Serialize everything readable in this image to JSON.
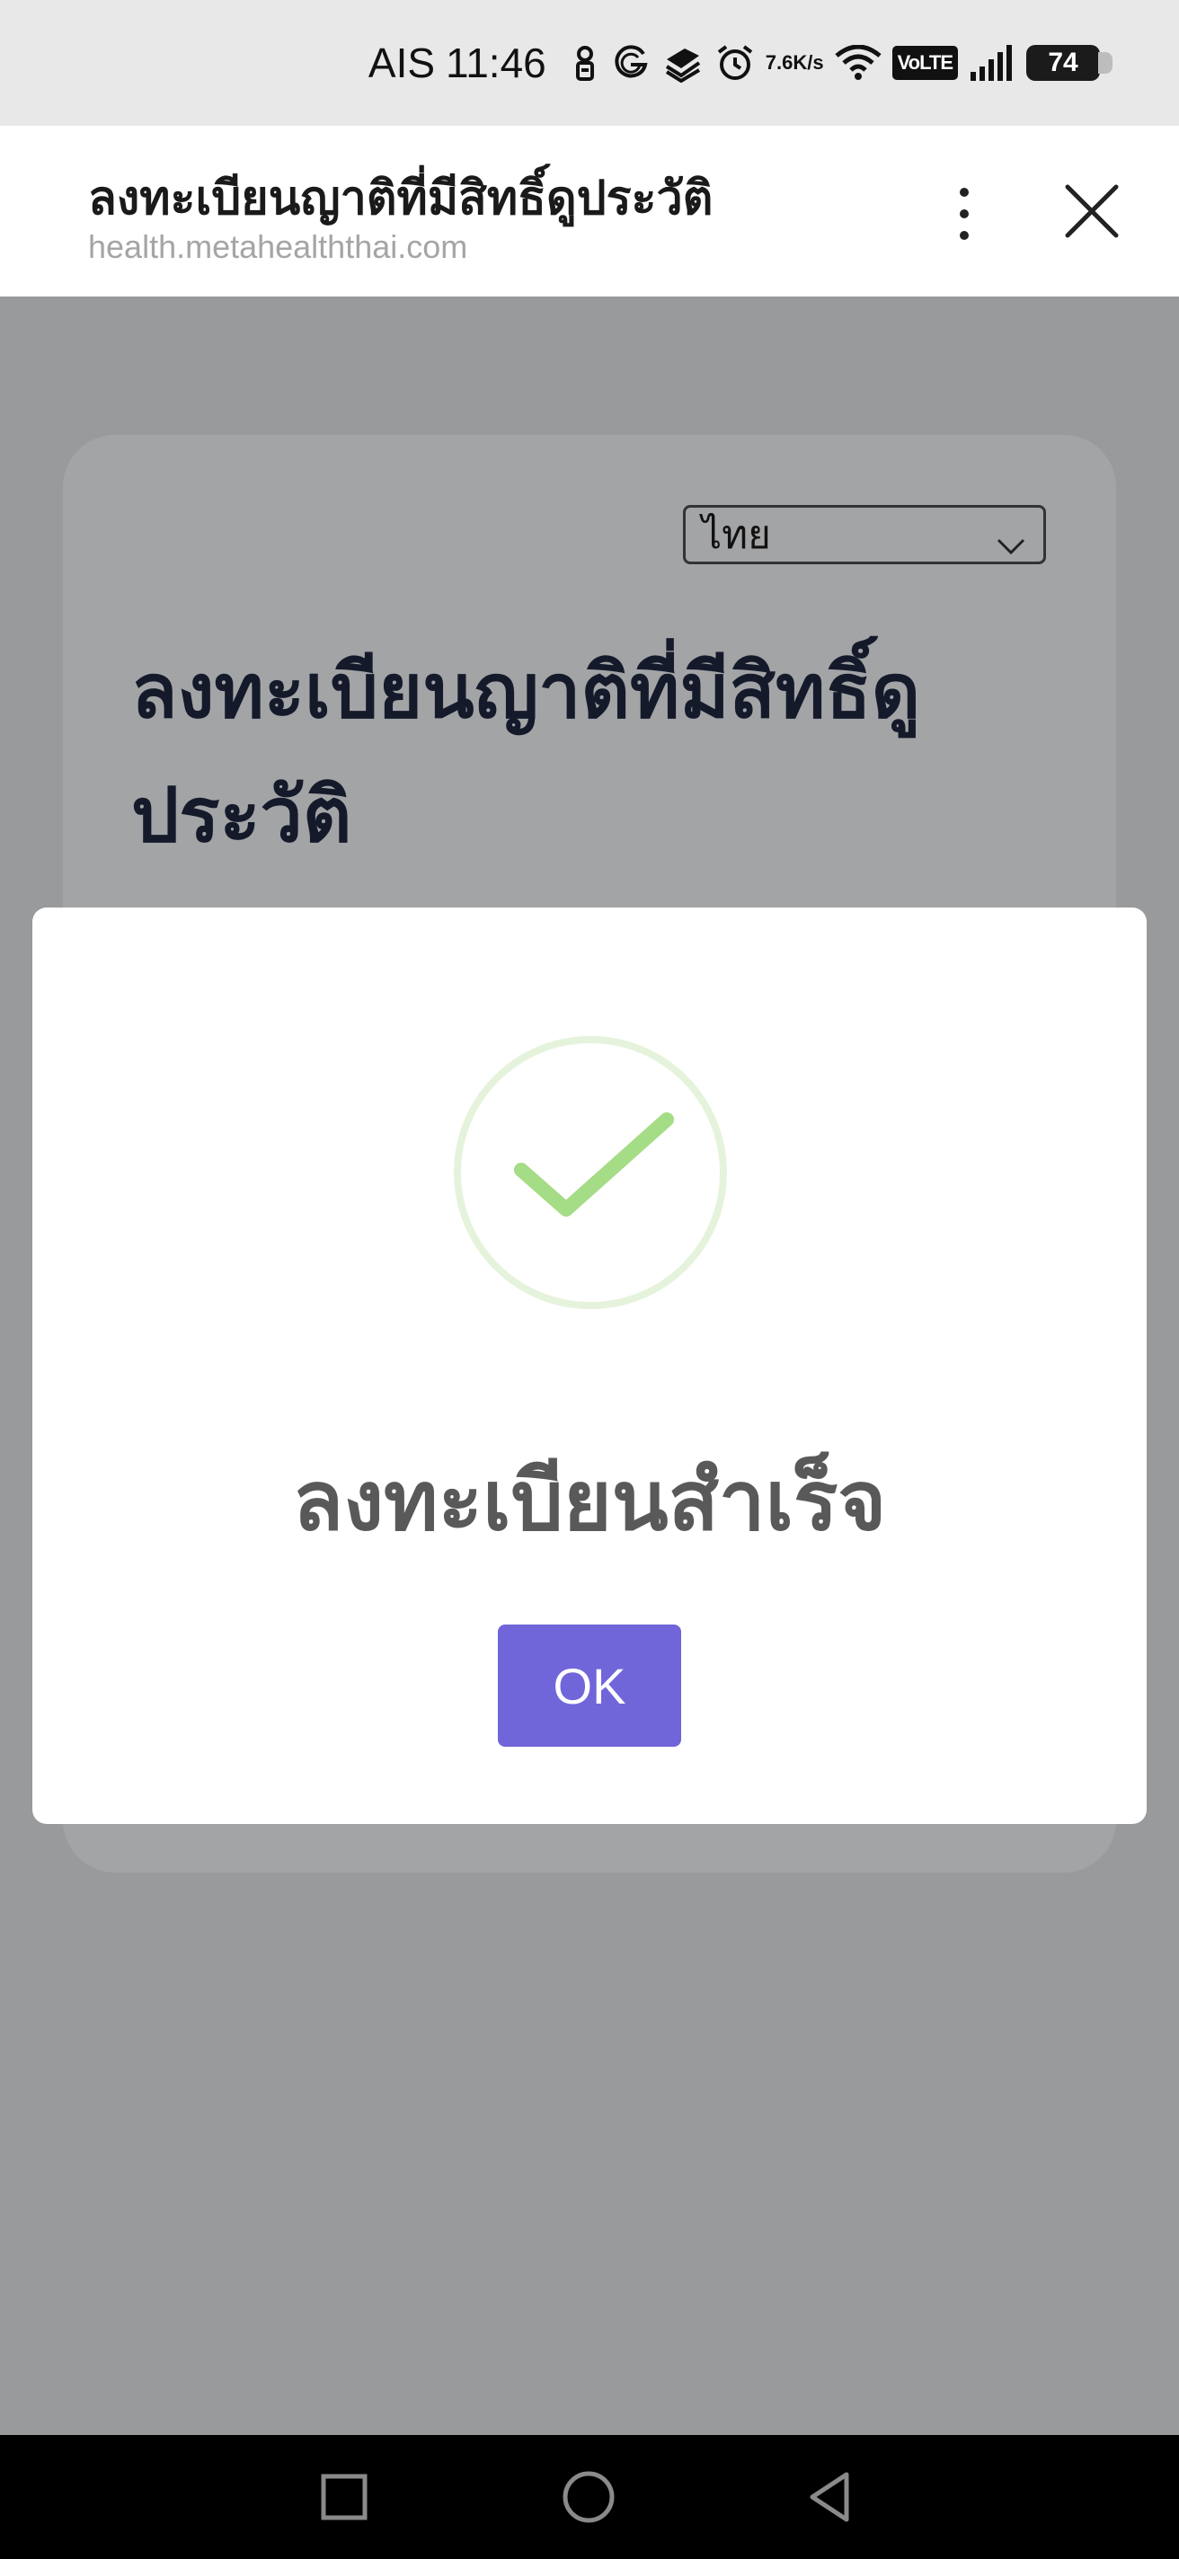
{
  "status_bar": {
    "carrier": "AIS",
    "time": "11:46",
    "net_speed_value": "7.6",
    "net_speed_unit": "K/s",
    "volte": "VoLTE",
    "battery": "74",
    "icons": [
      "hotspot-icon",
      "g-icon",
      "stack-icon",
      "alarm-icon",
      "wifi-icon",
      "signal-icon"
    ]
  },
  "browser": {
    "title": "ลงทะเบียนญาติที่มีสิทธิ์ดูประวัติ",
    "url": "health.metahealththai.com",
    "more_icon": "more-vertical-icon",
    "close_icon": "close-icon"
  },
  "form": {
    "language_select": {
      "selected": "ไทย"
    },
    "title": "ลงทะเบียนญาติที่มีสิทธิ์ดูประวัติ"
  },
  "dialog": {
    "icon": "success-check-icon",
    "message": "ลงทะเบียนสำเร็จ",
    "ok_label": "OK",
    "accent": "#7066d9",
    "check_color": "#a5dc86"
  },
  "nav_bar": {
    "icons": [
      "recents-icon",
      "home-icon",
      "back-icon"
    ]
  }
}
